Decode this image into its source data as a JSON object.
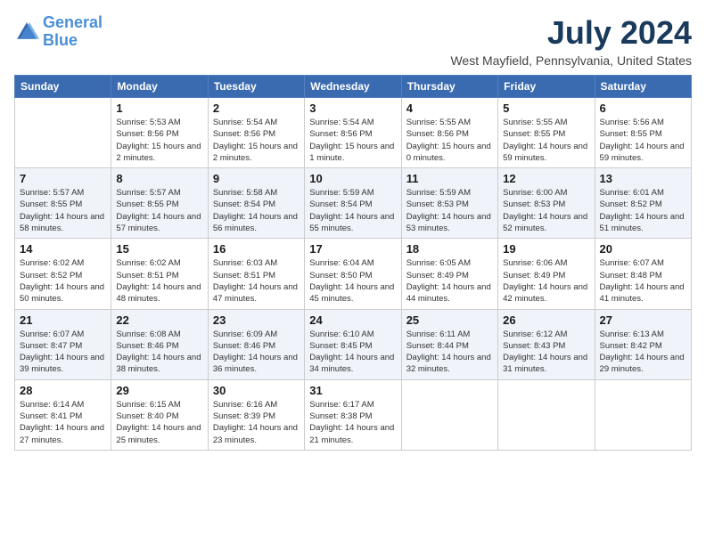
{
  "logo": {
    "text_general": "General",
    "text_blue": "Blue"
  },
  "title": "July 2024",
  "location": "West Mayfield, Pennsylvania, United States",
  "days_of_week": [
    "Sunday",
    "Monday",
    "Tuesday",
    "Wednesday",
    "Thursday",
    "Friday",
    "Saturday"
  ],
  "weeks": [
    [
      {
        "day": "",
        "sunrise": "",
        "sunset": "",
        "daylight": ""
      },
      {
        "day": "1",
        "sunrise": "Sunrise: 5:53 AM",
        "sunset": "Sunset: 8:56 PM",
        "daylight": "Daylight: 15 hours and 2 minutes."
      },
      {
        "day": "2",
        "sunrise": "Sunrise: 5:54 AM",
        "sunset": "Sunset: 8:56 PM",
        "daylight": "Daylight: 15 hours and 2 minutes."
      },
      {
        "day": "3",
        "sunrise": "Sunrise: 5:54 AM",
        "sunset": "Sunset: 8:56 PM",
        "daylight": "Daylight: 15 hours and 1 minute."
      },
      {
        "day": "4",
        "sunrise": "Sunrise: 5:55 AM",
        "sunset": "Sunset: 8:56 PM",
        "daylight": "Daylight: 15 hours and 0 minutes."
      },
      {
        "day": "5",
        "sunrise": "Sunrise: 5:55 AM",
        "sunset": "Sunset: 8:55 PM",
        "daylight": "Daylight: 14 hours and 59 minutes."
      },
      {
        "day": "6",
        "sunrise": "Sunrise: 5:56 AM",
        "sunset": "Sunset: 8:55 PM",
        "daylight": "Daylight: 14 hours and 59 minutes."
      }
    ],
    [
      {
        "day": "7",
        "sunrise": "Sunrise: 5:57 AM",
        "sunset": "Sunset: 8:55 PM",
        "daylight": "Daylight: 14 hours and 58 minutes."
      },
      {
        "day": "8",
        "sunrise": "Sunrise: 5:57 AM",
        "sunset": "Sunset: 8:55 PM",
        "daylight": "Daylight: 14 hours and 57 minutes."
      },
      {
        "day": "9",
        "sunrise": "Sunrise: 5:58 AM",
        "sunset": "Sunset: 8:54 PM",
        "daylight": "Daylight: 14 hours and 56 minutes."
      },
      {
        "day": "10",
        "sunrise": "Sunrise: 5:59 AM",
        "sunset": "Sunset: 8:54 PM",
        "daylight": "Daylight: 14 hours and 55 minutes."
      },
      {
        "day": "11",
        "sunrise": "Sunrise: 5:59 AM",
        "sunset": "Sunset: 8:53 PM",
        "daylight": "Daylight: 14 hours and 53 minutes."
      },
      {
        "day": "12",
        "sunrise": "Sunrise: 6:00 AM",
        "sunset": "Sunset: 8:53 PM",
        "daylight": "Daylight: 14 hours and 52 minutes."
      },
      {
        "day": "13",
        "sunrise": "Sunrise: 6:01 AM",
        "sunset": "Sunset: 8:52 PM",
        "daylight": "Daylight: 14 hours and 51 minutes."
      }
    ],
    [
      {
        "day": "14",
        "sunrise": "Sunrise: 6:02 AM",
        "sunset": "Sunset: 8:52 PM",
        "daylight": "Daylight: 14 hours and 50 minutes."
      },
      {
        "day": "15",
        "sunrise": "Sunrise: 6:02 AM",
        "sunset": "Sunset: 8:51 PM",
        "daylight": "Daylight: 14 hours and 48 minutes."
      },
      {
        "day": "16",
        "sunrise": "Sunrise: 6:03 AM",
        "sunset": "Sunset: 8:51 PM",
        "daylight": "Daylight: 14 hours and 47 minutes."
      },
      {
        "day": "17",
        "sunrise": "Sunrise: 6:04 AM",
        "sunset": "Sunset: 8:50 PM",
        "daylight": "Daylight: 14 hours and 45 minutes."
      },
      {
        "day": "18",
        "sunrise": "Sunrise: 6:05 AM",
        "sunset": "Sunset: 8:49 PM",
        "daylight": "Daylight: 14 hours and 44 minutes."
      },
      {
        "day": "19",
        "sunrise": "Sunrise: 6:06 AM",
        "sunset": "Sunset: 8:49 PM",
        "daylight": "Daylight: 14 hours and 42 minutes."
      },
      {
        "day": "20",
        "sunrise": "Sunrise: 6:07 AM",
        "sunset": "Sunset: 8:48 PM",
        "daylight": "Daylight: 14 hours and 41 minutes."
      }
    ],
    [
      {
        "day": "21",
        "sunrise": "Sunrise: 6:07 AM",
        "sunset": "Sunset: 8:47 PM",
        "daylight": "Daylight: 14 hours and 39 minutes."
      },
      {
        "day": "22",
        "sunrise": "Sunrise: 6:08 AM",
        "sunset": "Sunset: 8:46 PM",
        "daylight": "Daylight: 14 hours and 38 minutes."
      },
      {
        "day": "23",
        "sunrise": "Sunrise: 6:09 AM",
        "sunset": "Sunset: 8:46 PM",
        "daylight": "Daylight: 14 hours and 36 minutes."
      },
      {
        "day": "24",
        "sunrise": "Sunrise: 6:10 AM",
        "sunset": "Sunset: 8:45 PM",
        "daylight": "Daylight: 14 hours and 34 minutes."
      },
      {
        "day": "25",
        "sunrise": "Sunrise: 6:11 AM",
        "sunset": "Sunset: 8:44 PM",
        "daylight": "Daylight: 14 hours and 32 minutes."
      },
      {
        "day": "26",
        "sunrise": "Sunrise: 6:12 AM",
        "sunset": "Sunset: 8:43 PM",
        "daylight": "Daylight: 14 hours and 31 minutes."
      },
      {
        "day": "27",
        "sunrise": "Sunrise: 6:13 AM",
        "sunset": "Sunset: 8:42 PM",
        "daylight": "Daylight: 14 hours and 29 minutes."
      }
    ],
    [
      {
        "day": "28",
        "sunrise": "Sunrise: 6:14 AM",
        "sunset": "Sunset: 8:41 PM",
        "daylight": "Daylight: 14 hours and 27 minutes."
      },
      {
        "day": "29",
        "sunrise": "Sunrise: 6:15 AM",
        "sunset": "Sunset: 8:40 PM",
        "daylight": "Daylight: 14 hours and 25 minutes."
      },
      {
        "day": "30",
        "sunrise": "Sunrise: 6:16 AM",
        "sunset": "Sunset: 8:39 PM",
        "daylight": "Daylight: 14 hours and 23 minutes."
      },
      {
        "day": "31",
        "sunrise": "Sunrise: 6:17 AM",
        "sunset": "Sunset: 8:38 PM",
        "daylight": "Daylight: 14 hours and 21 minutes."
      },
      {
        "day": "",
        "sunrise": "",
        "sunset": "",
        "daylight": ""
      },
      {
        "day": "",
        "sunrise": "",
        "sunset": "",
        "daylight": ""
      },
      {
        "day": "",
        "sunrise": "",
        "sunset": "",
        "daylight": ""
      }
    ]
  ]
}
